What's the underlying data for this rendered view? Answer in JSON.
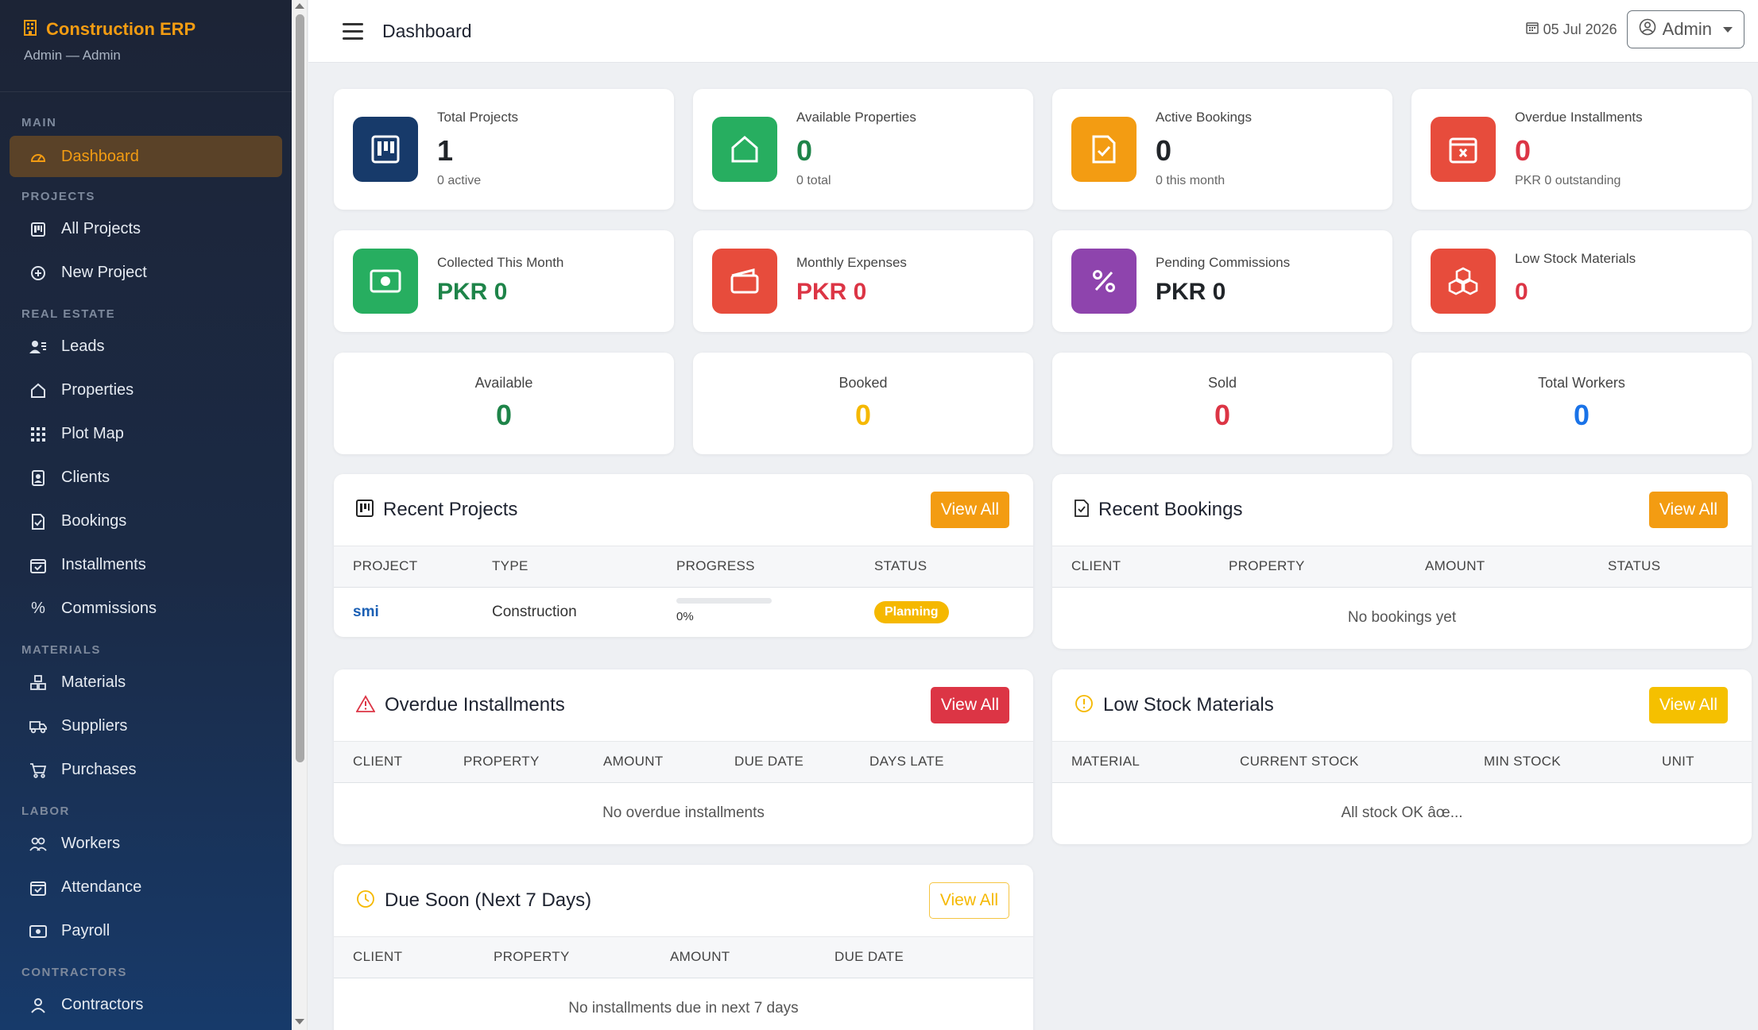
{
  "sidebar": {
    "brand_title": "Construction ERP",
    "brand_sub": "Admin — Admin",
    "sections": {
      "main": "MAIN",
      "projects": "PROJECTS",
      "real_estate": "REAL ESTATE",
      "materials": "MATERIALS",
      "labor": "LABOR",
      "contractors": "CONTRACTORS"
    },
    "items": {
      "dashboard": "Dashboard",
      "all_projects": "All Projects",
      "new_project": "New Project",
      "leads": "Leads",
      "properties": "Properties",
      "plot_map": "Plot Map",
      "clients": "Clients",
      "bookings": "Bookings",
      "installments": "Installments",
      "commissions": "Commissions",
      "materials": "Materials",
      "suppliers": "Suppliers",
      "purchases": "Purchases",
      "workers": "Workers",
      "attendance": "Attendance",
      "payroll": "Payroll",
      "contractors": "Contractors"
    }
  },
  "topbar": {
    "title": "Dashboard",
    "date": "05 Jul 2026",
    "user": "Admin"
  },
  "stats": {
    "total_projects": {
      "label": "Total Projects",
      "value": "1",
      "sub": "0 active"
    },
    "available_properties": {
      "label": "Available Properties",
      "value": "0",
      "sub": "0 total"
    },
    "active_bookings": {
      "label": "Active Bookings",
      "value": "0",
      "sub": "0 this month"
    },
    "overdue_installments": {
      "label": "Overdue Installments",
      "value": "0",
      "sub": "PKR 0 outstanding"
    },
    "collected_month": {
      "label": "Collected This Month",
      "value": "PKR 0"
    },
    "monthly_expenses": {
      "label": "Monthly Expenses",
      "value": "PKR 0"
    },
    "pending_commissions": {
      "label": "Pending Commissions",
      "value": "PKR 0"
    },
    "low_stock": {
      "label": "Low Stock Materials",
      "value": "0"
    }
  },
  "summary": {
    "available": {
      "label": "Available",
      "value": "0"
    },
    "booked": {
      "label": "Booked",
      "value": "0"
    },
    "sold": {
      "label": "Sold",
      "value": "0"
    },
    "workers": {
      "label": "Total Workers",
      "value": "0"
    }
  },
  "recent_projects": {
    "title": "Recent Projects",
    "view_all": "View All",
    "headers": [
      "PROJECT",
      "TYPE",
      "PROGRESS",
      "STATUS"
    ],
    "rows": [
      {
        "name": "smi",
        "type": "Construction",
        "progress_label": "0%",
        "progress": 0,
        "status": "Planning"
      }
    ]
  },
  "recent_bookings": {
    "title": "Recent Bookings",
    "view_all": "View All",
    "headers": [
      "CLIENT",
      "PROPERTY",
      "AMOUNT",
      "STATUS"
    ],
    "empty": "No bookings yet"
  },
  "overdue_panel": {
    "title": "Overdue Installments",
    "view_all": "View All",
    "headers": [
      "CLIENT",
      "PROPERTY",
      "AMOUNT",
      "DUE DATE",
      "DAYS LATE"
    ],
    "empty": "No overdue installments"
  },
  "low_stock_panel": {
    "title": "Low Stock Materials",
    "view_all": "View All",
    "headers": [
      "MATERIAL",
      "CURRENT STOCK",
      "MIN STOCK",
      "UNIT"
    ],
    "empty": "All stock OK âœ..."
  },
  "due_soon": {
    "title": "Due Soon (Next 7 Days)",
    "view_all": "View All",
    "headers": [
      "CLIENT",
      "PROPERTY",
      "AMOUNT",
      "DUE DATE"
    ],
    "empty": "No installments due in next 7 days"
  },
  "colors": {
    "navy": "#173a6a",
    "green": "#27ae60",
    "orange": "#f39c12",
    "red": "#e74c3c",
    "purple": "#8e44ad",
    "blue": "#1a73e8",
    "yellow": "#f5b800"
  }
}
